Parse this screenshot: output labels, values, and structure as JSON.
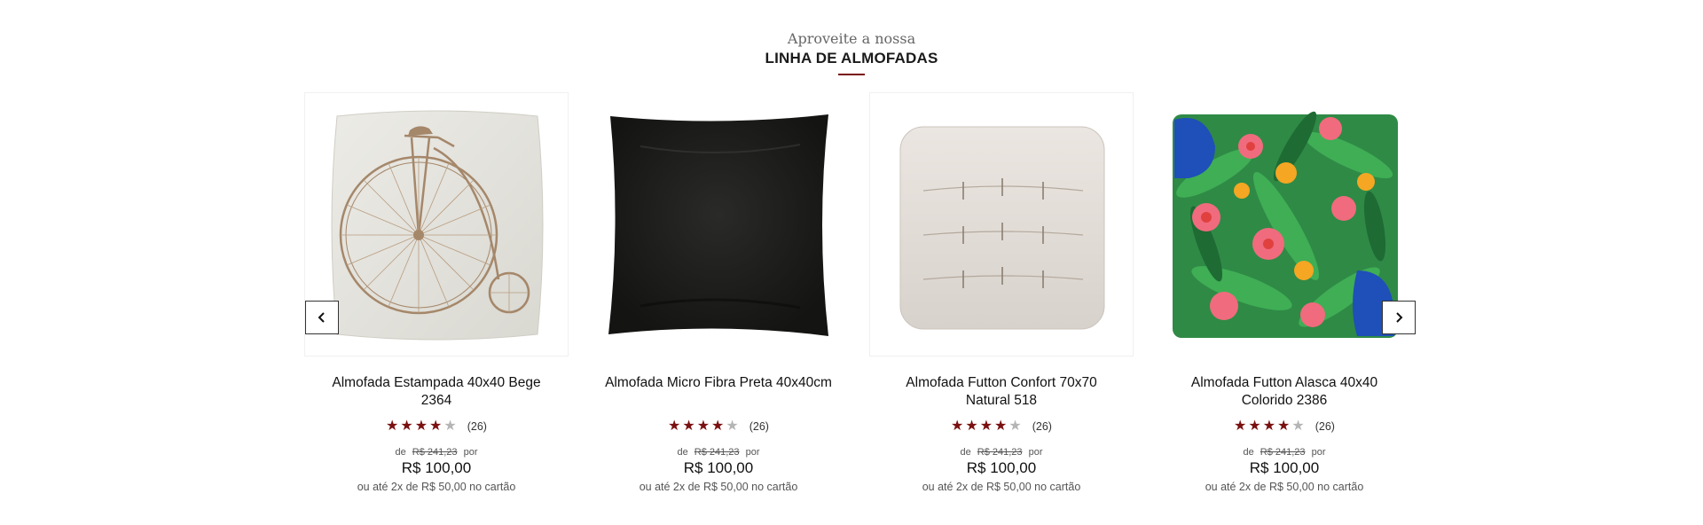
{
  "section": {
    "kicker": "Aproveite a nossa",
    "title": "LINHA DE ALMOFADAS",
    "accent_color": "#7a1010"
  },
  "navigation": {
    "prev_icon": "chevron-left-icon",
    "next_icon": "chevron-right-icon"
  },
  "products": [
    {
      "name": "Almofada Estampada 40x40 Bege 2364",
      "image": "bicycle-print-beige-pillow",
      "rating": 4,
      "rating_max": 5,
      "reviews": "(26)",
      "old_prefix": "de",
      "old_price": "R$ 241,23",
      "old_suffix": "por",
      "price": "R$ 100,00",
      "installments": "ou até 2x de R$ 50,00 no cartão"
    },
    {
      "name": "Almofada Micro Fibra Preta 40x40cm",
      "image": "black-pillow",
      "rating": 4,
      "rating_max": 5,
      "reviews": "(26)",
      "old_prefix": "de",
      "old_price": "R$ 241,23",
      "old_suffix": "por",
      "price": "R$ 100,00",
      "installments": "ou até 2x de R$ 50,00 no cartão"
    },
    {
      "name": "Almofada Futton Confort 70x70 Natural 518",
      "image": "natural-futton-cushion",
      "rating": 4,
      "rating_max": 5,
      "reviews": "(26)",
      "old_prefix": "de",
      "old_price": "R$ 241,23",
      "old_suffix": "por",
      "price": "R$ 100,00",
      "installments": "ou até 2x de R$ 50,00 no cartão"
    },
    {
      "name": "Almofada Futton Alasca 40x40 Colorido 2386",
      "image": "tropical-floral-futton-cushion",
      "rating": 4,
      "rating_max": 5,
      "reviews": "(26)",
      "old_prefix": "de",
      "old_price": "R$ 241,23",
      "old_suffix": "por",
      "price": "R$ 100,00",
      "installments": "ou até 2x de R$ 50,00 no cartão"
    }
  ]
}
